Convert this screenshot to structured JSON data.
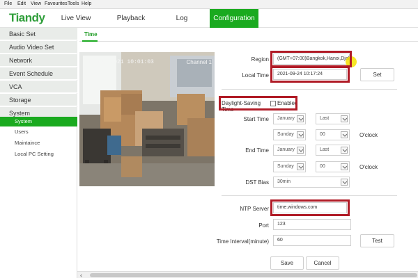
{
  "menubar": {
    "items": [
      "File",
      "Edit",
      "View",
      "Favourites",
      "Tools",
      "Help"
    ]
  },
  "brand": {
    "logo": "Tiandy",
    "accent_color": "#1aaa1f",
    "highlight_color": "#b01b26"
  },
  "topnav": {
    "tabs": [
      {
        "label": "Live View"
      },
      {
        "label": "Playback"
      },
      {
        "label": "Log"
      },
      {
        "label": "Configuration",
        "active": true
      }
    ]
  },
  "sidebar": {
    "items": [
      {
        "label": "Basic Set"
      },
      {
        "label": "Audio Video Set"
      },
      {
        "label": "Network"
      },
      {
        "label": "Event Schedule"
      },
      {
        "label": "VCA"
      },
      {
        "label": "Storage"
      },
      {
        "label": "System"
      }
    ],
    "sub_items": [
      {
        "label": "System",
        "active": true
      },
      {
        "label": "Users"
      },
      {
        "label": "Maintaince"
      },
      {
        "label": "Local PC Setting"
      }
    ]
  },
  "content": {
    "tab": "Time"
  },
  "preview": {
    "osd_time": "Jun 24, 2021 10:01:03",
    "osd_channel": "Channel 1"
  },
  "form": {
    "region": {
      "label": "Region",
      "value": "(GMT+07:00)Bangkok,Hanoi,Djakarta"
    },
    "local_time": {
      "label": "Local Time",
      "value": "2021-09-24 10:17:24",
      "button": "Set"
    },
    "dst": {
      "label": "Daylight-Saving Time",
      "checkbox_label": "Enabled",
      "checked": false
    },
    "start_time": {
      "label": "Start Time",
      "month": "January",
      "week": "Last",
      "day": "Sunday",
      "hour": "00",
      "suffix": "O'clock"
    },
    "end_time": {
      "label": "End Time",
      "month": "January",
      "week": "Last",
      "day": "Sunday",
      "hour": "00",
      "suffix": "O'clock"
    },
    "dst_bias": {
      "label": "DST Bias",
      "value": "30min"
    },
    "ntp_server": {
      "label": "NTP Server",
      "value": "time.windows.com"
    },
    "port": {
      "label": "Port",
      "value": "123"
    },
    "interval": {
      "label": "Time Interval(minute)",
      "value": "60",
      "button": "Test"
    },
    "save": "Save",
    "cancel": "Cancel"
  },
  "icons": {
    "chevron": "chevron-down-icon",
    "scroll_left": "arrow-left-icon"
  }
}
